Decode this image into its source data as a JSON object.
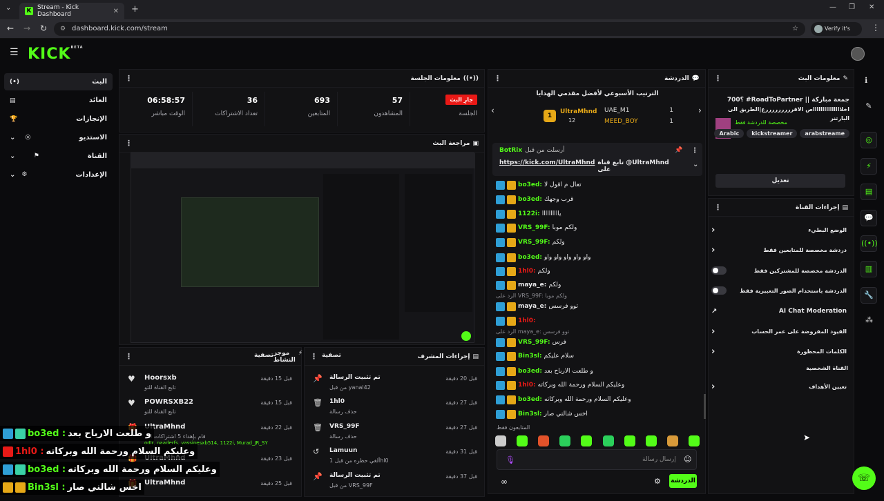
{
  "browser": {
    "tab_title": "Stream - Kick Dashboard",
    "url": "dashboard.kick.com/stream",
    "verify": "Verify it's you"
  },
  "header": {
    "logo": "KICK",
    "logo_sup": "BETA"
  },
  "nav": {
    "items": [
      {
        "label": "البث",
        "icon": "(•)"
      },
      {
        "label": "العائد",
        "icon": "▤"
      },
      {
        "label": "الإنجازات",
        "icon": "🏆"
      },
      {
        "label": "الاستديو",
        "icon": "◎"
      },
      {
        "label": "القناة",
        "icon": "⚑"
      },
      {
        "label": "الإعدادات",
        "icon": "⚙"
      }
    ]
  },
  "session": {
    "title": "معلومات الجلسة",
    "live_label": "جارِ البث",
    "session_label": "الجلسة",
    "stats": [
      {
        "value": "57",
        "label": "المشاهدون"
      },
      {
        "value": "693",
        "label": "المتابعين"
      },
      {
        "value": "36",
        "label": "تعداد الاشتراكات"
      },
      {
        "value": "06:58:57",
        "label": "الوقت مباشر"
      }
    ]
  },
  "preview": {
    "title": "مراجعة البث"
  },
  "activity": {
    "title": "موجز النشاط",
    "filter": "تصفية",
    "items": [
      {
        "name": "Hoorsxb",
        "sub": "تابع القناة للتو",
        "time": "قبل 15 دقيقة"
      },
      {
        "name": "POWRSXB22",
        "sub": "تابع القناة للتو",
        "time": "قبل 15 دقيقة"
      },
      {
        "name": "UltraMhnd",
        "sub": "قام بإهداء 5 اشتراكات الى",
        "sub2": "odlr, naaderfs, yassinesxb514, 1122i, Murad_JR_SY",
        "time": "قبل 22 دقيقة"
      },
      {
        "name": "UltraMhnd",
        "sub": "",
        "time": "قبل 23 دقيقة"
      },
      {
        "name": "UltraMhnd",
        "sub": "",
        "time": "قبل 25 دقيقة"
      }
    ]
  },
  "modactions": {
    "title": "إجراءات المشرف",
    "filter": "تصفية",
    "items": [
      {
        "name": "تم تثبيت الرسالة",
        "sub": "من قبل yanal42",
        "time": "قبل 20 دقيقة",
        "icon": "pin"
      },
      {
        "name": "1hl0",
        "sub": "حذف رسالة",
        "time": "قبل 27 دقيقة",
        "icon": "trash"
      },
      {
        "name": "VRS_99F",
        "sub": "حذف رسالة",
        "time": "قبل 27 دقيقة",
        "icon": "trash"
      },
      {
        "name": "Lamuun",
        "sub": "ألغي حظره من قبل 1hl0",
        "time": "قبل 31 دقيقة",
        "icon": "undo"
      },
      {
        "name": "تم تثبيت الرسالة",
        "sub": "من قبل VRS_99F",
        "time": "قبل 37 دقيقة",
        "icon": "pin"
      }
    ]
  },
  "chat": {
    "title": "الدردشة",
    "leaderboard_title": "الترتيب الأسبوعي لأفضل مقدمي الهدايا",
    "top1": {
      "name": "UltraMhnd",
      "count": "12",
      "rank": "1"
    },
    "top2": {
      "name": "UAE_M1",
      "count": "1"
    },
    "top3": {
      "name": "MEED_BOY",
      "count": "1"
    },
    "pinned_by": "أرسلت من قبل",
    "pinned_user": "BotRix",
    "pinned_text": "تابع قناة @UltraMhnd على",
    "pinned_link": "https://kick.com/UltraMhnd",
    "messages": [
      {
        "user": "bo3ed:",
        "text": "تعال م اقول لا",
        "color": "#53fc18"
      },
      {
        "user": "bo3ed:",
        "text": "قرب وجهك",
        "color": "#53fc18"
      },
      {
        "user": "1122i:",
        "text": "ياااااااااا",
        "color": "#53fc18"
      },
      {
        "user": "VRS_99F:",
        "text": "ولكم موبا",
        "color": "#53fc18"
      },
      {
        "user": "VRS_99F:",
        "text": "ولكم",
        "color": "#53fc18"
      },
      {
        "user": "bo3ed:",
        "text": "واو واو واو واو واو",
        "color": "#53fc18"
      },
      {
        "user": "1hl0:",
        "text": "ولكم",
        "color": "#e91916"
      },
      {
        "user": "maya_e:",
        "text": "ولكم",
        "color": "#e8e8ea"
      },
      {
        "user": "maya_e:",
        "text": "توو فرسس",
        "color": "#e8e8ea",
        "reply": "الرد على VRS_99F: ولكم موبا"
      },
      {
        "user": "1hl0:",
        "text": "",
        "color": "#e91916"
      },
      {
        "user": "VRS_99F:",
        "text": "فرس",
        "color": "#53fc18",
        "reply": "الرد على maya_e: توو فرسس"
      },
      {
        "user": "Bin3sl:",
        "text": "سلام عليكم",
        "color": "#53fc18"
      },
      {
        "user": "bo3ed:",
        "text": "و طلعت الارباح بعد",
        "color": "#53fc18"
      },
      {
        "user": "1hl0:",
        "text": "وعليكم السلام ورحمة الله وبركاته",
        "color": "#e91916"
      },
      {
        "user": "bo3ed:",
        "text": "وعليكم السلام ورحمة الله وبركاته",
        "color": "#53fc18"
      },
      {
        "user": "Bin3sl:",
        "text": "اخس شالني صار",
        "color": "#53fc18"
      }
    ],
    "followers_only": "المتابعون فقط",
    "input_placeholder": "إرسال رسالة",
    "send": "الدردشة",
    "ellipsis_count": "∞"
  },
  "streaminfo": {
    "title": "معلومات البث",
    "stream_title": "700؟ #RoadToPartner || جمعة مباركة",
    "stream_title2": "اخلاااااااااااااااص الاقرررررررررع|الطريق الى البارتنر",
    "category": "مخصصة للدردشة فقط",
    "tags": [
      "arabstreame",
      "kickstreamer",
      "Arabic"
    ],
    "edit": "تعديل"
  },
  "channelactions": {
    "title": "إجراءات القناة",
    "items": [
      {
        "label": "الوضع البطيء",
        "control": "chevron"
      },
      {
        "label": "دردشة مخصصة للمتابعين فقط",
        "control": "chevron"
      },
      {
        "label": "الدردشة مخصصة للمشتركين فقط",
        "control": "toggle"
      },
      {
        "label": "الدردشة باستخدام الصور التعبيرية فقط",
        "control": "toggle"
      },
      {
        "label": "AI Chat Moderation",
        "control": "external"
      },
      {
        "label": "القيود المفروضة على عمر الحساب",
        "control": "chevron"
      },
      {
        "label": "الكلمات المحظورة",
        "control": "chevron"
      }
    ],
    "personal": "القناة الشخصية",
    "goals": "تعيين الأهداف"
  },
  "overlay": {
    "lines": [
      {
        "user": "bo3ed :",
        "text": "و طلعت الارباح بعد",
        "color": "#53fc18",
        "badges": [
          "blue",
          "green"
        ]
      },
      {
        "user": "1hl0 :",
        "text": "وعليكم السلام ورحمة الله وبركاته",
        "color": "#e91916",
        "badges": [
          "red"
        ]
      },
      {
        "user": "bo3ed :",
        "text": "وعليكم السلام ورحمة الله وبركاته",
        "color": "#53fc18",
        "badges": [
          "blue",
          "green"
        ]
      },
      {
        "user": "Bin3sl :",
        "text": "اخس شالني صار",
        "color": "#53fc18",
        "badges": [
          "gold",
          "gold"
        ]
      }
    ]
  },
  "colors": {
    "accent": "#53fc18",
    "live": "#e91916",
    "bg": "#0b0b0d",
    "panel": "#121214"
  }
}
